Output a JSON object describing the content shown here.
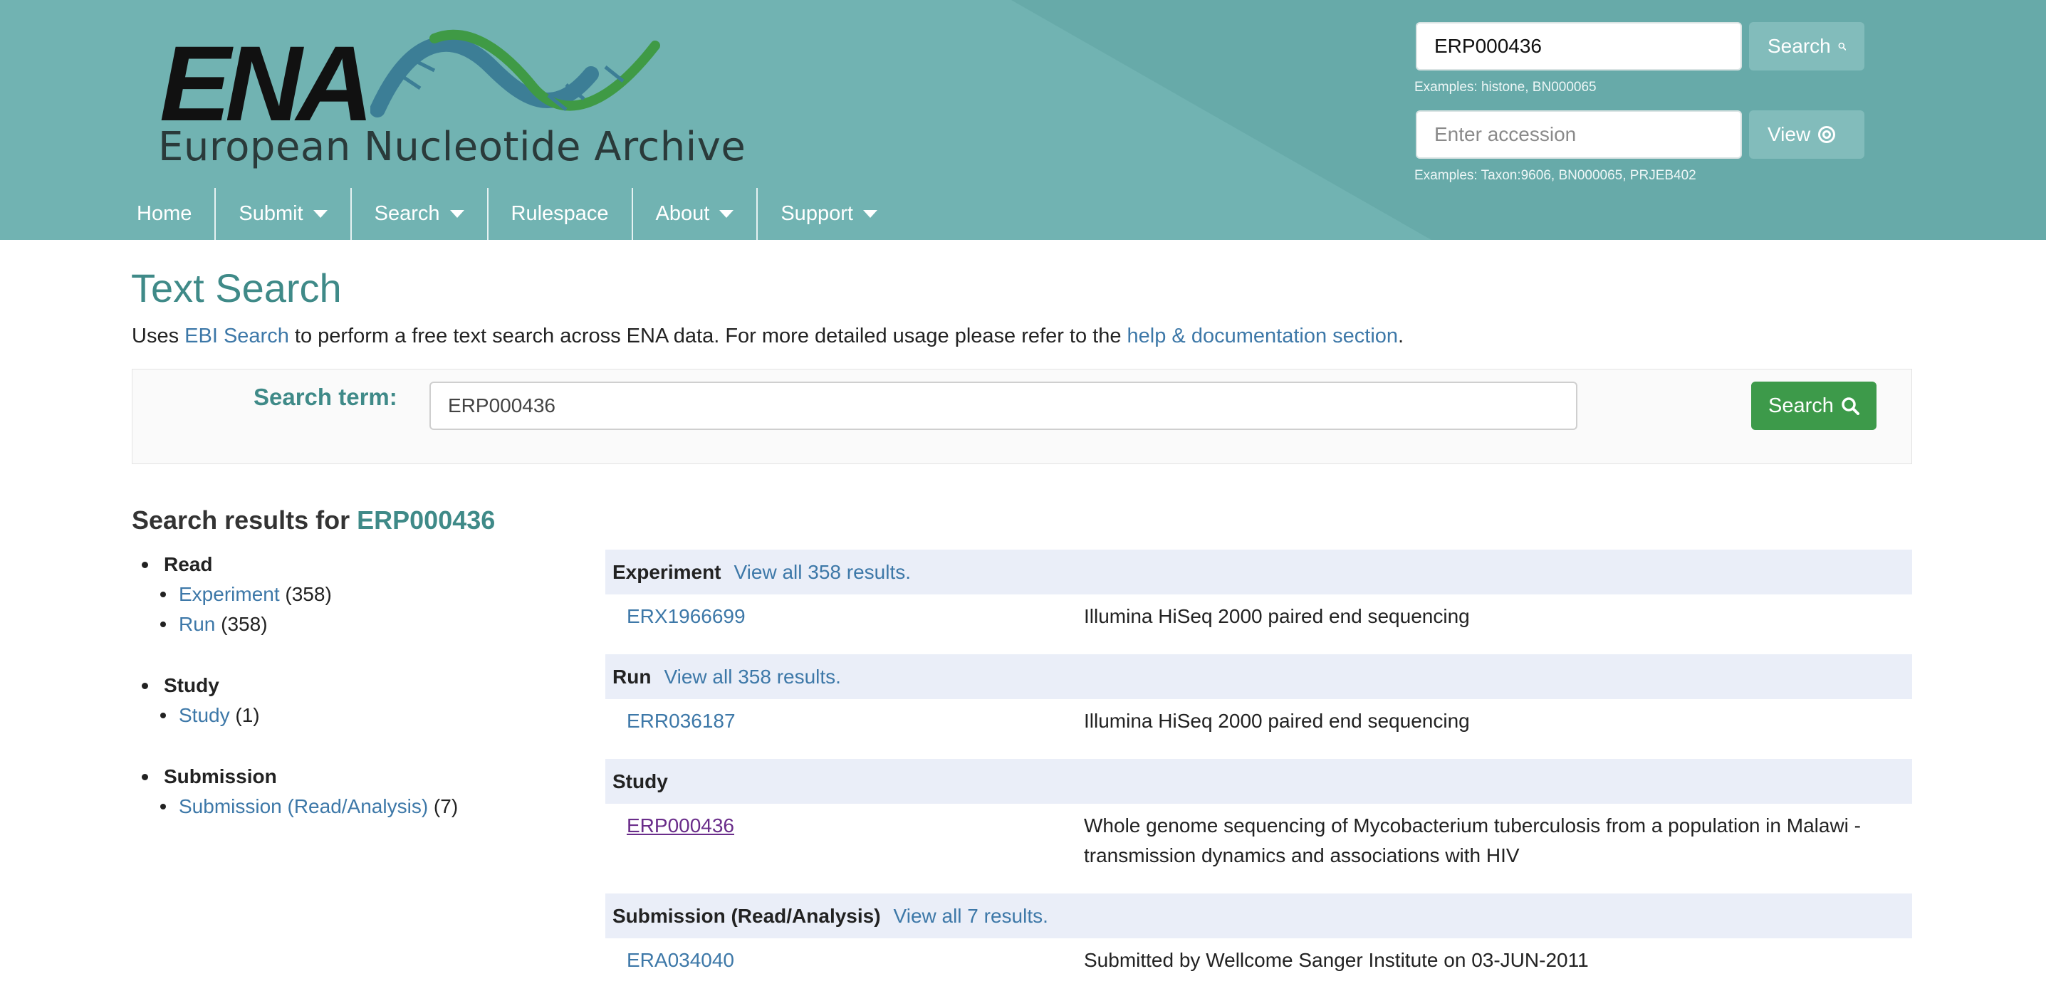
{
  "header": {
    "logo_text": "ENA",
    "logo_subtitle": "European Nucleotide Archive",
    "search_value": "ERP000436",
    "search_label": "Search",
    "search_hint": "Examples: histone, BN000065",
    "accession_placeholder": "Enter accession",
    "view_label": "View",
    "accession_hint": "Examples: Taxon:9606, BN000065, PRJEB402"
  },
  "nav": {
    "items": [
      {
        "label": "Home"
      },
      {
        "label": "Submit"
      },
      {
        "label": "Search"
      },
      {
        "label": "Rulespace"
      },
      {
        "label": "About"
      },
      {
        "label": "Support"
      }
    ]
  },
  "page": {
    "title": "Text Search",
    "intro_pre": "Uses ",
    "intro_link1": "EBI Search",
    "intro_mid": " to perform a free text search across ENA data. For more detailed usage please refer to the ",
    "intro_link2": "help & documentation section",
    "intro_post": "."
  },
  "search_form": {
    "label": "Search term:",
    "value": "ERP000436",
    "button": "Search"
  },
  "results": {
    "heading_prefix": "Search results for ",
    "term": "ERP000436",
    "facets": [
      {
        "group": "Read",
        "items": [
          {
            "link": "Experiment",
            "count": "(358)"
          },
          {
            "link": "Run",
            "count": "(358)"
          }
        ]
      },
      {
        "group": "Study",
        "items": [
          {
            "link": "Study",
            "count": "(1)"
          }
        ]
      },
      {
        "group": "Submission",
        "items": [
          {
            "link": "Submission (Read/Analysis)",
            "count": "(7)"
          }
        ]
      }
    ],
    "sections": [
      {
        "title": "Experiment",
        "view_all": "View all 358 results.",
        "accession": "ERX1966699",
        "description": "Illumina HiSeq 2000 paired end sequencing"
      },
      {
        "title": "Run",
        "view_all": "View all 358 results.",
        "accession": "ERR036187",
        "description": "Illumina HiSeq 2000 paired end sequencing"
      },
      {
        "title": "Study",
        "view_all": "",
        "accession": "ERP000436",
        "description": "Whole genome sequencing of Mycobacterium tuberculosis from a population in Malawi - transmission dynamics and associations with HIV"
      },
      {
        "title": "Submission (Read/Analysis)",
        "view_all": "View all 7 results.",
        "accession": "ERA034040",
        "description": "Submitted by Wellcome Sanger Institute on 03-JUN-2011"
      }
    ]
  },
  "colors": {
    "header_bg": "#71b3b2",
    "title_teal": "#3f8a88",
    "link_blue": "#3d78a8",
    "search_green": "#3d9a4a",
    "section_bg": "#eaeef8"
  }
}
